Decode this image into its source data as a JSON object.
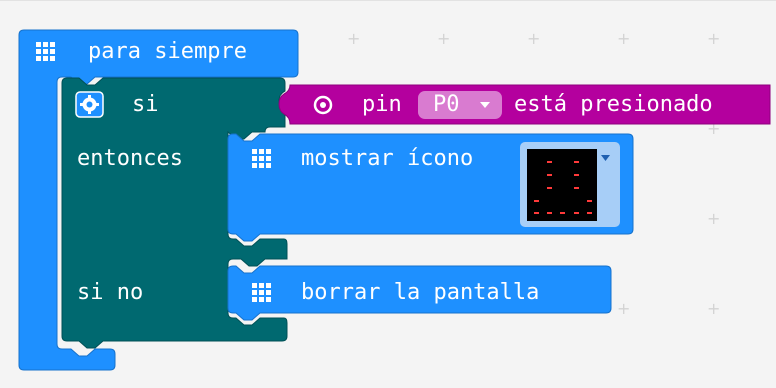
{
  "colors": {
    "basic": "#1e90ff",
    "logic": "#006970",
    "input": "#b4009e",
    "dropdown_bg": "#d97bd0",
    "icon_bg": "#a7cef7",
    "led_on": "#ff3a3a",
    "workspace": "#f4f4f4"
  },
  "forever_block": {
    "label": "para siempre",
    "icon": "grid-icon"
  },
  "if_block": {
    "label_if": "si",
    "label_then": "entonces",
    "label_else": "si no",
    "gear_icon": "gear-icon"
  },
  "condition_block": {
    "icon": "target-icon",
    "label_pin": "pin",
    "pin_value": "P0",
    "label_pressed": "está presionado"
  },
  "show_icon_block": {
    "label": "mostrar ícono",
    "icon": "grid-icon"
  },
  "clear_screen_block": {
    "label": "borrar la pantalla",
    "icon": "grid-icon"
  }
}
